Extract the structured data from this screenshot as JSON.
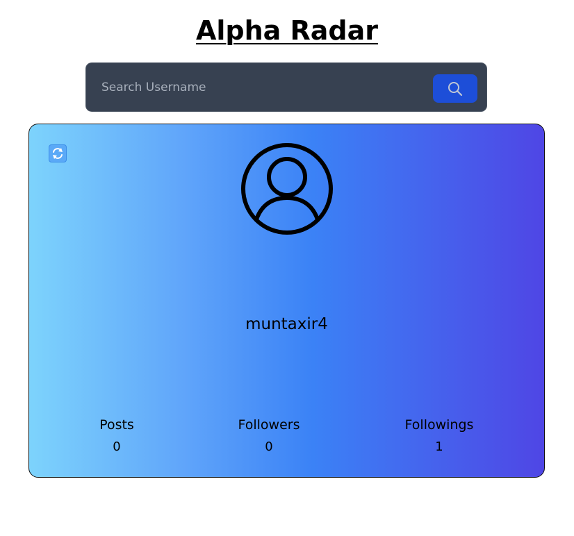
{
  "header": {
    "title": "Alpha Radar"
  },
  "search": {
    "placeholder": "Search Username",
    "value": "",
    "button_icon": "search-icon"
  },
  "profile": {
    "refresh_icon": "refresh-icon",
    "avatar_icon": "user-circle-icon",
    "username": "muntaxir4",
    "stats": {
      "posts_label": "Posts",
      "posts_value": "0",
      "followers_label": "Followers",
      "followers_value": "0",
      "followings_label": "Followings",
      "followings_value": "1"
    }
  },
  "colors": {
    "search_bar_bg": "#374151",
    "search_button_bg": "#1d4ed8",
    "card_gradient_start": "#7dd3fc",
    "card_gradient_end": "#4f46e5"
  }
}
